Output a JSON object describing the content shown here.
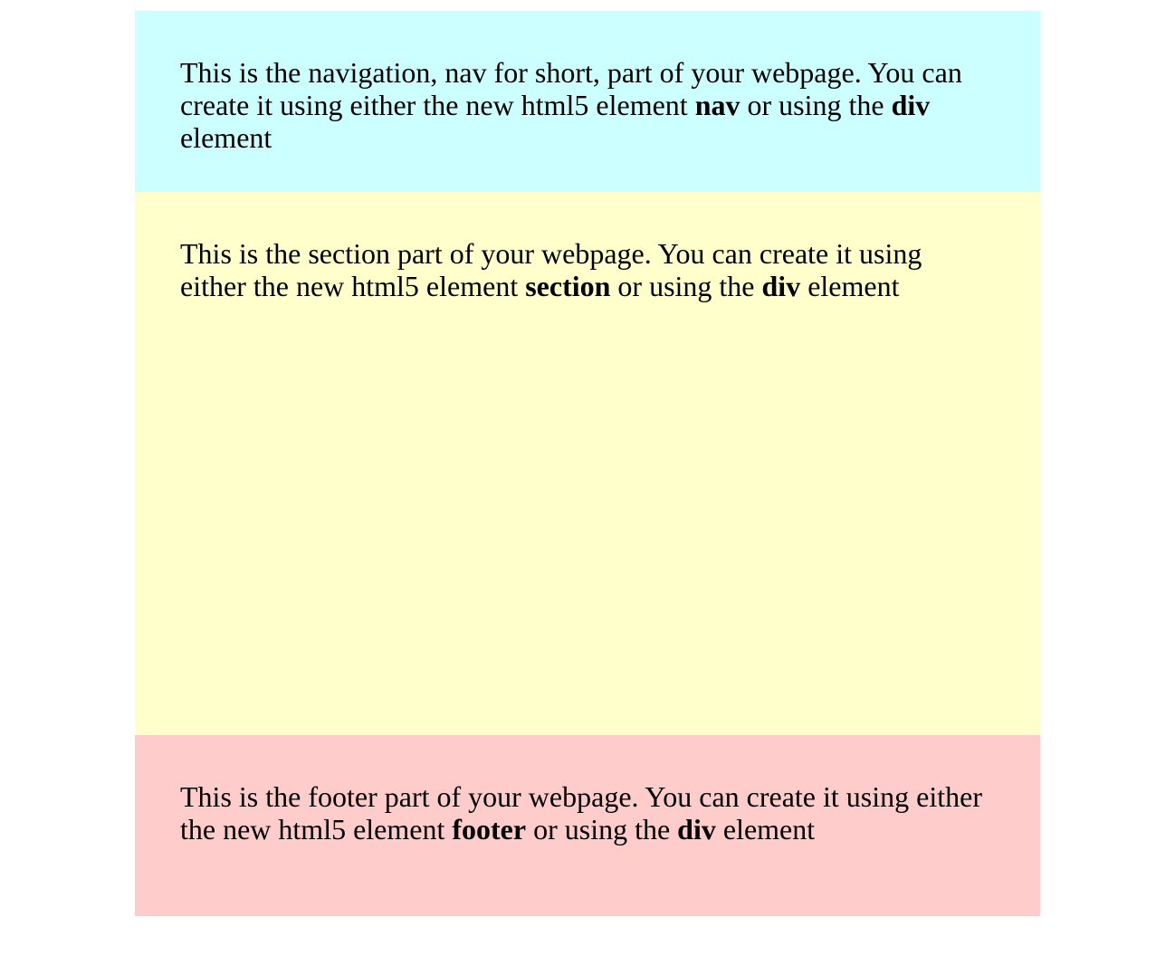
{
  "colors": {
    "nav_bg": "#ccffff",
    "section_bg": "#ffffcc",
    "footer_bg": "#ffcccc"
  },
  "nav": {
    "text_before": "This is the navigation, nav for short, part of your webpage. You can create it using either the new html5 element ",
    "bold_1": "nav",
    "text_middle": " or using the ",
    "bold_2": "div",
    "text_after": " element"
  },
  "section": {
    "text_before": "This is the section part of your webpage. You can create it using either the new html5 element ",
    "bold_1": "section",
    "text_middle": " or using the ",
    "bold_2": "div",
    "text_after": " element"
  },
  "footer": {
    "text_before": "This is the footer part of your webpage. You can create it using either the new html5 element ",
    "bold_1": "footer",
    "text_middle": " or using the ",
    "bold_2": "div",
    "text_after": " element"
  }
}
